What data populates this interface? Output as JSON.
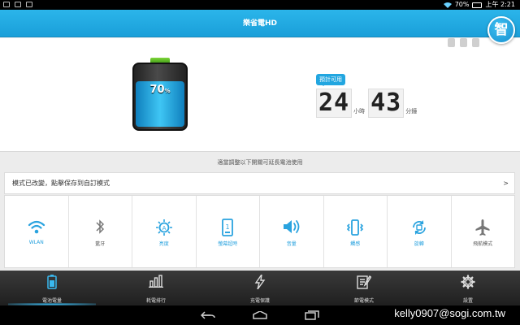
{
  "status_bar": {
    "battery_pct": "70%",
    "time": "上午 2:21"
  },
  "app": {
    "title": "樂省電HD",
    "assistant_label": "智"
  },
  "battery": {
    "level": 0.7,
    "percent_label": "70",
    "percent_sign": "%"
  },
  "prediction": {
    "tag": "預計可用",
    "hours": "24",
    "hours_unit": "小時",
    "minutes": "43",
    "minutes_unit": "分鐘"
  },
  "hint": "適當調整以下開關可延長電池使用",
  "mode_bar": {
    "text": "模式已改變，點擊保存到自訂模式",
    "arrow": ">"
  },
  "toggles": [
    {
      "label": "WLAN",
      "icon": "wifi-icon",
      "on": true
    },
    {
      "label": "藍牙",
      "icon": "bluetooth-icon",
      "on": false
    },
    {
      "label": "亮度",
      "icon": "brightness-icon",
      "on": true
    },
    {
      "label": "螢幕超時",
      "icon": "screen-timeout-icon",
      "on": true
    },
    {
      "label": "音量",
      "icon": "volume-icon",
      "on": true
    },
    {
      "label": "觸感",
      "icon": "vibrate-icon",
      "on": true
    },
    {
      "label": "旋轉",
      "icon": "rotate-icon",
      "on": true
    },
    {
      "label": "飛航模式",
      "icon": "airplane-icon",
      "on": false
    }
  ],
  "bottom_nav": [
    {
      "label": "電池電量",
      "icon": "battery-icon",
      "active": true
    },
    {
      "label": "耗電排行",
      "icon": "bar-chart-icon",
      "active": false
    },
    {
      "label": "充電保護",
      "icon": "bolt-icon",
      "active": false
    },
    {
      "label": "節電模式",
      "icon": "edit-doc-icon",
      "active": false
    },
    {
      "label": "設置",
      "icon": "gear-icon",
      "active": false
    }
  ],
  "watermark": "kelly0907@sogi.com.tw",
  "colors": {
    "accent": "#1fa8e3",
    "title_bar": "#22aee6",
    "nav_bg": "#2a2a2a"
  }
}
